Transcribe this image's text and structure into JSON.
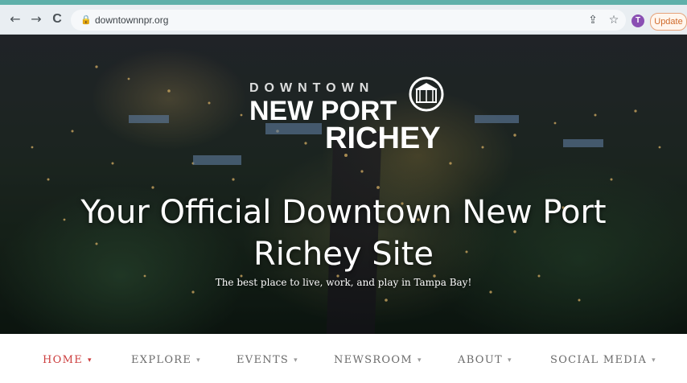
{
  "browser": {
    "url": "downtownnpr.org",
    "back_glyph": "←",
    "forward_glyph": "→",
    "reload_glyph": "C",
    "lock_glyph": "🔒",
    "share_glyph": "⇪",
    "star_glyph": "☆",
    "avatar_initial": "T",
    "update_label": "Update",
    "accent_color": "#5fb0aa"
  },
  "hero": {
    "logo": {
      "top_word": "DOWNTOWN",
      "line1": "NEW PORT",
      "line2": "RICHEY"
    },
    "headline": "Your Official Downtown New Port Richey Site",
    "subline": "The best place to live, work, and play in Tampa Bay!"
  },
  "menu": {
    "items": [
      {
        "label": "HOME",
        "active": true
      },
      {
        "label": "EXPLORE",
        "active": false
      },
      {
        "label": "EVENTS",
        "active": false
      },
      {
        "label": "NEWSROOM",
        "active": false
      },
      {
        "label": "ABOUT",
        "active": false
      },
      {
        "label": "SOCIAL MEDIA",
        "active": false
      }
    ],
    "caret_glyph": "▾",
    "active_color": "#cc3d3d"
  }
}
